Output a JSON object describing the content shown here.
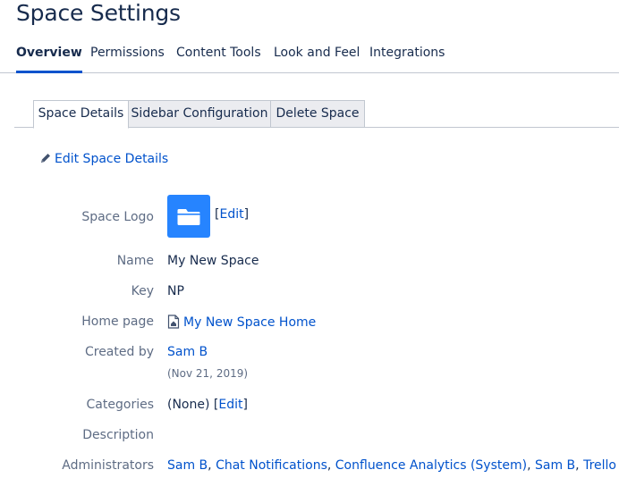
{
  "page": {
    "title": "Space Settings"
  },
  "nav": {
    "items": [
      {
        "label": "Overview",
        "active": true
      },
      {
        "label": "Permissions",
        "active": false
      },
      {
        "label": "Content Tools",
        "active": false
      },
      {
        "label": "Look and Feel",
        "active": false
      },
      {
        "label": "Integrations",
        "active": false
      }
    ],
    "accent_color": "#0052cc"
  },
  "tabs": [
    {
      "label": "Space Details",
      "active": true
    },
    {
      "label": "Sidebar Configuration",
      "active": false
    },
    {
      "label": "Delete Space",
      "active": false
    }
  ],
  "edit_details": {
    "label": "Edit Space Details",
    "icon": "pencil-icon"
  },
  "details": {
    "logo": {
      "label": "Space Logo",
      "icon": "folder-icon",
      "color": "#2684ff",
      "edit_label": "Edit",
      "edit_prefix": "[",
      "edit_suffix": "]"
    },
    "name": {
      "label": "Name",
      "value": "My New Space"
    },
    "key": {
      "label": "Key",
      "value": "NP"
    },
    "home_page": {
      "label": "Home page",
      "value": "My New Space Home",
      "icon": "home-page-icon"
    },
    "created_by": {
      "label": "Created by",
      "value": "Sam B",
      "date": "(Nov 21, 2019)"
    },
    "categories": {
      "label": "Categories",
      "value": "(None)",
      "edit_label": "Edit",
      "edit_prefix": "[",
      "edit_suffix": "]"
    },
    "description": {
      "label": "Description",
      "value": ""
    },
    "administrators": {
      "label": "Administrators",
      "items": [
        "Sam B",
        "Chat Notifications",
        "Confluence Analytics (System)",
        "Sam B",
        "Trello"
      ],
      "separator": ", "
    }
  }
}
